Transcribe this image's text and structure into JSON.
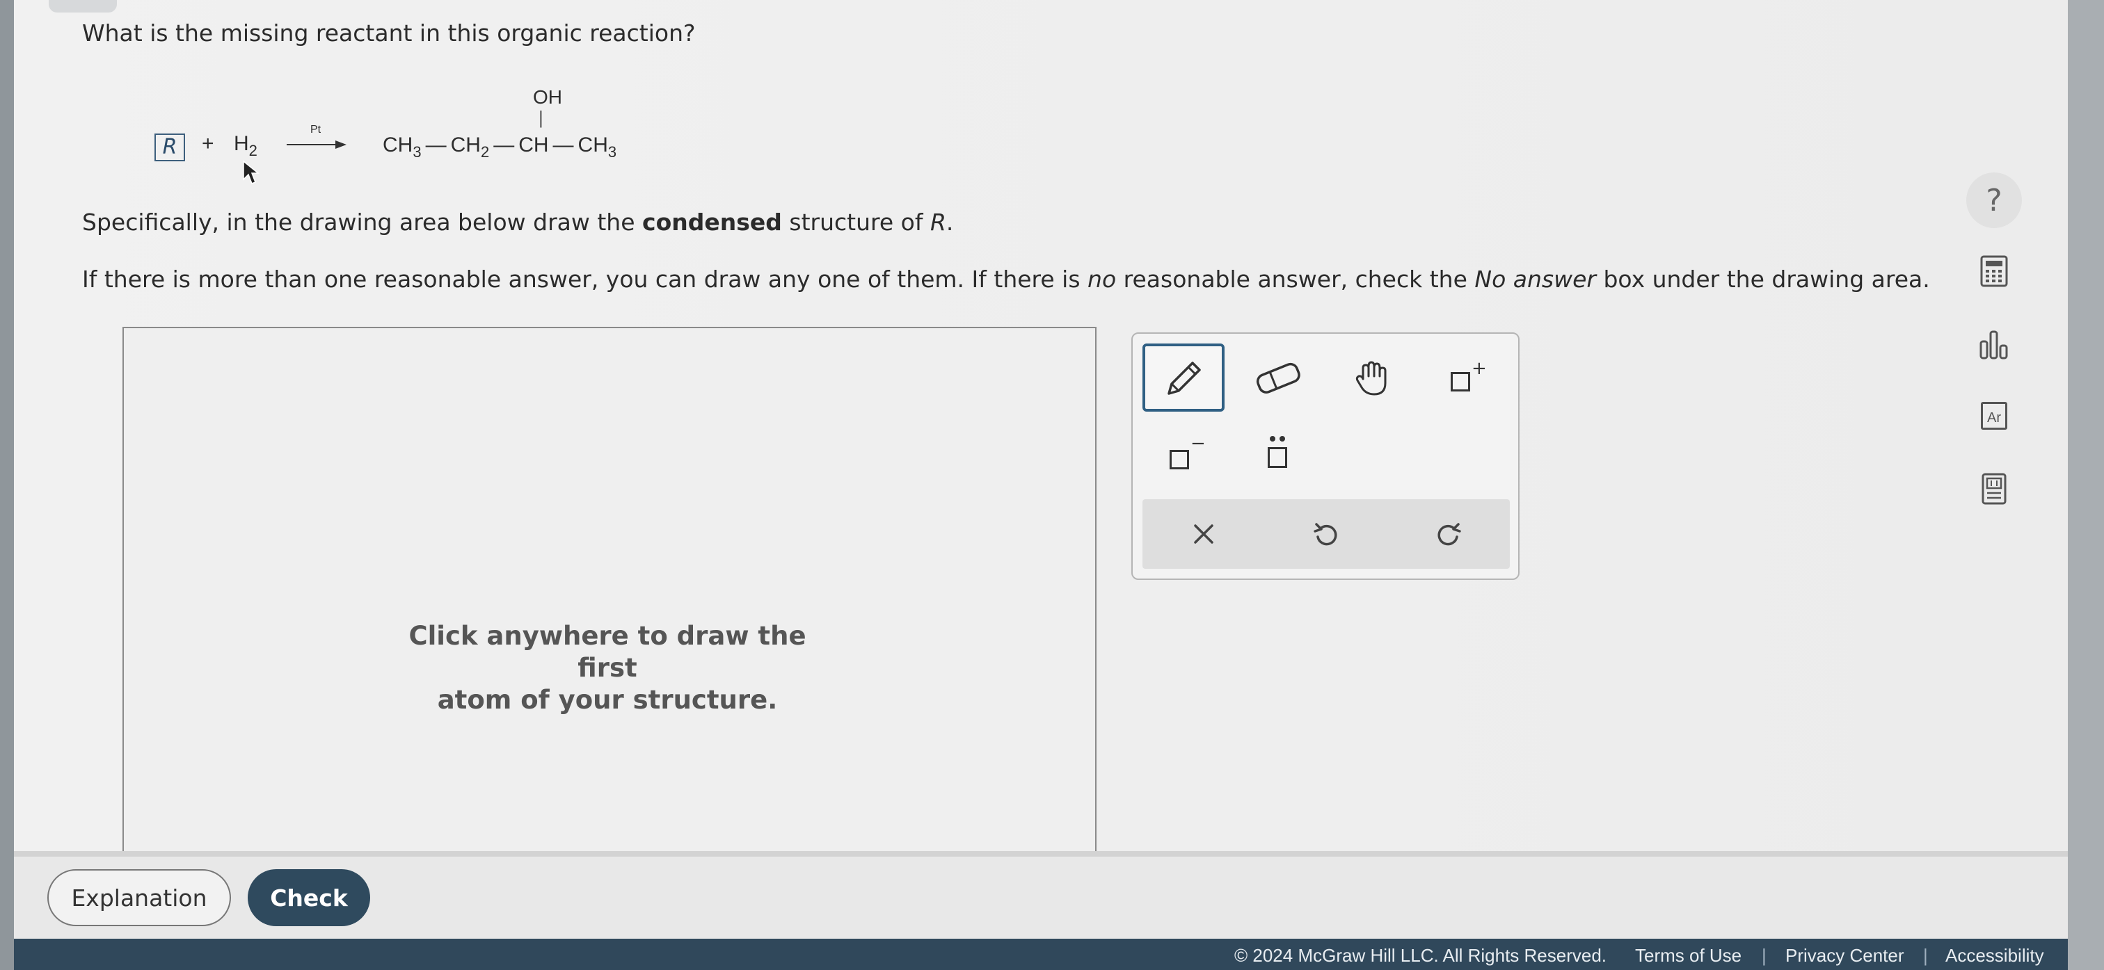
{
  "question": {
    "prompt": "What is the missing reactant in this organic reaction?",
    "instruction_pre": "Specifically, in the drawing area below draw the",
    "instruction_bold": "condensed",
    "instruction_post": "structure of",
    "instruction_var": "R",
    "instruction_end": ".",
    "note_a": "If there is more than one reasonable answer, you can draw any one of them. If there is",
    "note_no": "no",
    "note_b": "reasonable answer, check the",
    "note_noanswer": "No answer",
    "note_c": "box under the drawing area."
  },
  "reaction": {
    "reactant_box": "R",
    "plus": "+",
    "h": "H",
    "h_sub": "2",
    "catalyst": "Pt",
    "ch3_a": "CH",
    "ch3_a_sub": "3",
    "bond1": "—",
    "ch2": "CH",
    "ch2_sub": "2",
    "bond2": "—",
    "ch": "CH",
    "bond3": "—",
    "ch3_b": "CH",
    "ch3_b_sub": "3",
    "oh": "OH",
    "vbond": "|"
  },
  "drawing_area": {
    "hint_line1": "Click anywhere to draw the first",
    "hint_line2": "atom of your structure."
  },
  "toolbar": {
    "tools": [
      "pencil",
      "eraser",
      "hand",
      "positive-charge",
      "negative-charge",
      "lone-pair"
    ],
    "selected": "pencil",
    "plus_sign": "+",
    "minus_sign": "−"
  },
  "sidebar": {
    "help_label": "?",
    "periodic_label": "Ar"
  },
  "bottom": {
    "explanation_label": "Explanation",
    "check_label": "Check"
  },
  "footer": {
    "copyright": "© 2024 McGraw Hill LLC. All Rights Reserved.",
    "terms": "Terms of Use",
    "privacy": "Privacy Center",
    "accessibility": "Accessibility",
    "separator": "|"
  }
}
